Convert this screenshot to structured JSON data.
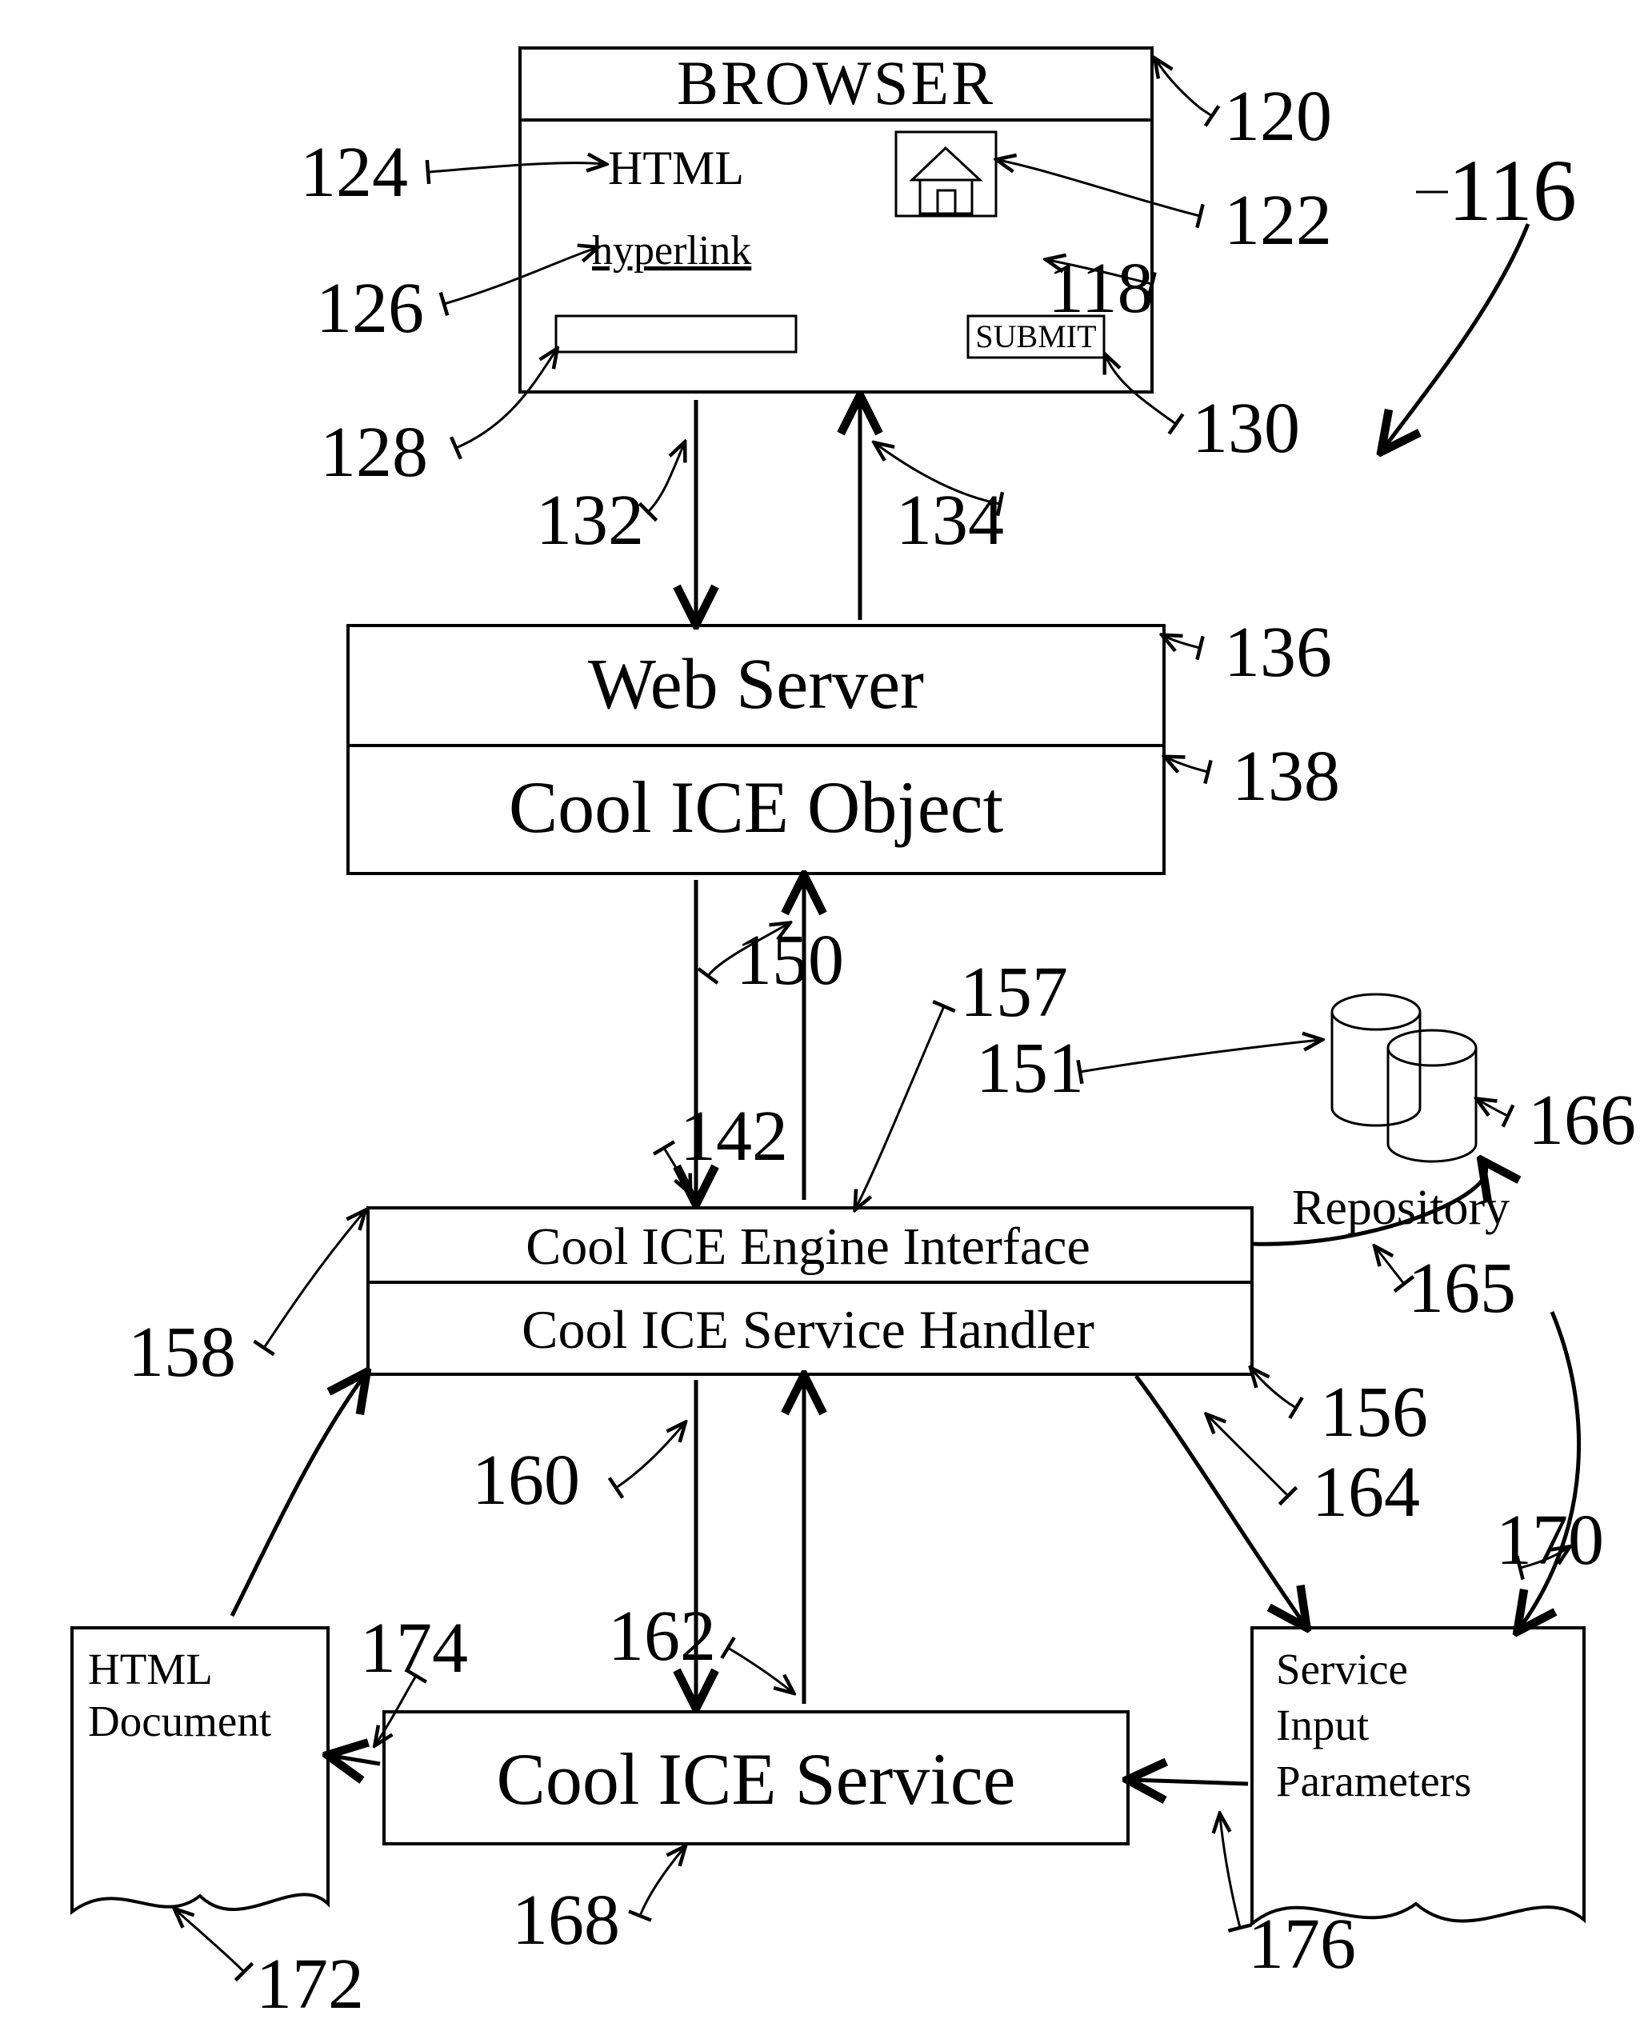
{
  "browser": {
    "title": "BROWSER",
    "html_label": "HTML",
    "hyperlink": "hyperlink",
    "submit": "SUBMIT"
  },
  "blocks": {
    "web_server": "Web Server",
    "cool_ice_object": "Cool ICE Object",
    "engine_interface": "Cool ICE Engine Interface",
    "service_handler": "Cool ICE Service Handler",
    "cool_ice_service": "Cool ICE Service",
    "repository": "Repository",
    "html_doc_l1": "HTML",
    "html_doc_l2": "Document",
    "sip_l1": "Service",
    "sip_l2": "Input",
    "sip_l3": "Parameters"
  },
  "refs": {
    "r116": "116",
    "r118": "118",
    "r120": "120",
    "r122": "122",
    "r124": "124",
    "r126": "126",
    "r128": "128",
    "r130": "130",
    "r132": "132",
    "r134": "134",
    "r136": "136",
    "r138": "138",
    "r142": "142",
    "r150": "150",
    "r151": "151",
    "r156": "156",
    "r157": "157",
    "r158": "158",
    "r160": "160",
    "r162": "162",
    "r164": "164",
    "r165": "165",
    "r166": "166",
    "r168": "168",
    "r170": "170",
    "r172": "172",
    "r174": "174",
    "r176": "176"
  }
}
